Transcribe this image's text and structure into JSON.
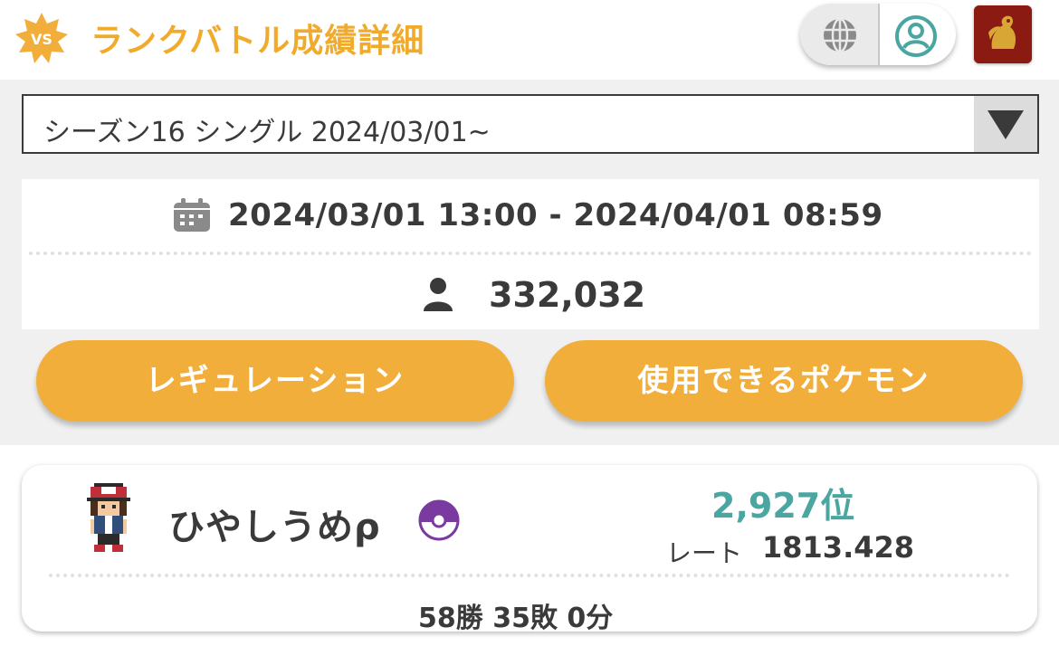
{
  "header": {
    "vs_badge": "VS",
    "title": "ランクバトル成績詳細",
    "icons": [
      "globe-icon",
      "user-circle-icon"
    ],
    "accent_color": "#f0ab2c"
  },
  "season_select": {
    "selected": "シーズン16 シングル 2024/03/01~"
  },
  "season_info": {
    "date_range": "2024/03/01 13:00 - 2024/04/01 08:59",
    "player_count": "332,032"
  },
  "buttons": {
    "regulation": "レギュレーション",
    "usable_pokemon": "使用できるポケモン",
    "color": "#f2ae3b"
  },
  "player": {
    "name": "ひやしうめρ",
    "rank": "2,927位",
    "rate_label": "レート",
    "rate_value": "1813.428",
    "record": "58勝 35敗 0分",
    "rank_color": "#4aa6a0"
  }
}
